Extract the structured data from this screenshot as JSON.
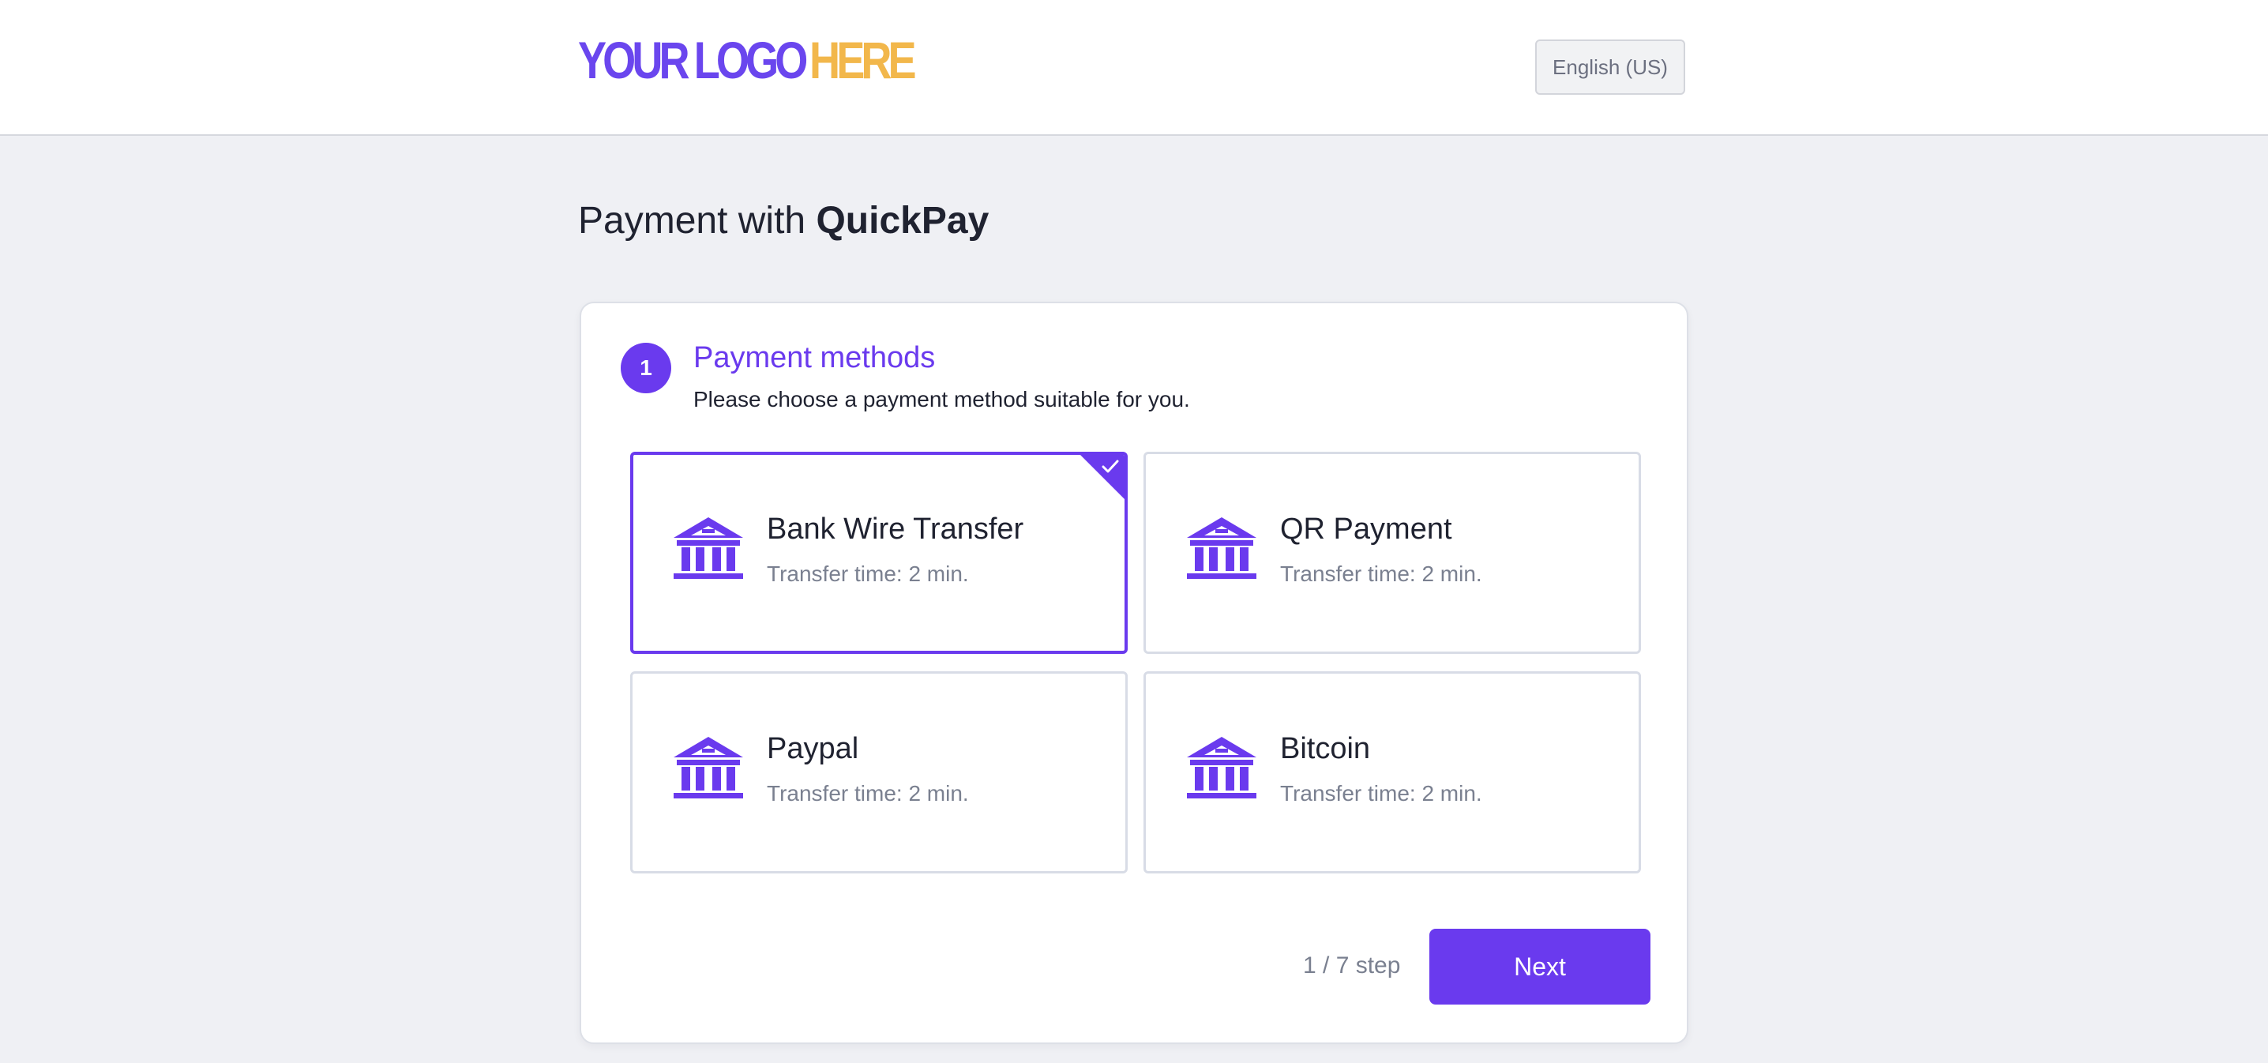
{
  "header": {
    "logo": {
      "main": "YOUR LOGO",
      "accent": "HERE"
    },
    "language_label": "English (US)"
  },
  "page": {
    "title_prefix": "Payment with",
    "title_brand": "QuickPay"
  },
  "step": {
    "number": "1",
    "title": "Payment methods",
    "subtitle": "Please choose a payment method suitable for you.",
    "counter": "1 / 7 step",
    "next_label": "Next"
  },
  "payment_methods": [
    {
      "name": "Bank Wire Transfer",
      "meta": "Transfer time: 2 min.",
      "icon": "bank-icon",
      "selected": true
    },
    {
      "name": "QR Payment",
      "meta": "Transfer time: 2 min.",
      "icon": "bank-icon",
      "selected": false
    },
    {
      "name": "Paypal",
      "meta": "Transfer time: 2 min.",
      "icon": "bank-icon",
      "selected": false
    },
    {
      "name": "Bitcoin",
      "meta": "Transfer time: 2 min.",
      "icon": "bank-icon",
      "selected": false
    }
  ],
  "colors": {
    "accent": "#6a3aee",
    "logo_main": "#6a46ee",
    "logo_accent": "#f2b74b",
    "background": "#eff0f4",
    "muted_text": "#7a8090"
  }
}
